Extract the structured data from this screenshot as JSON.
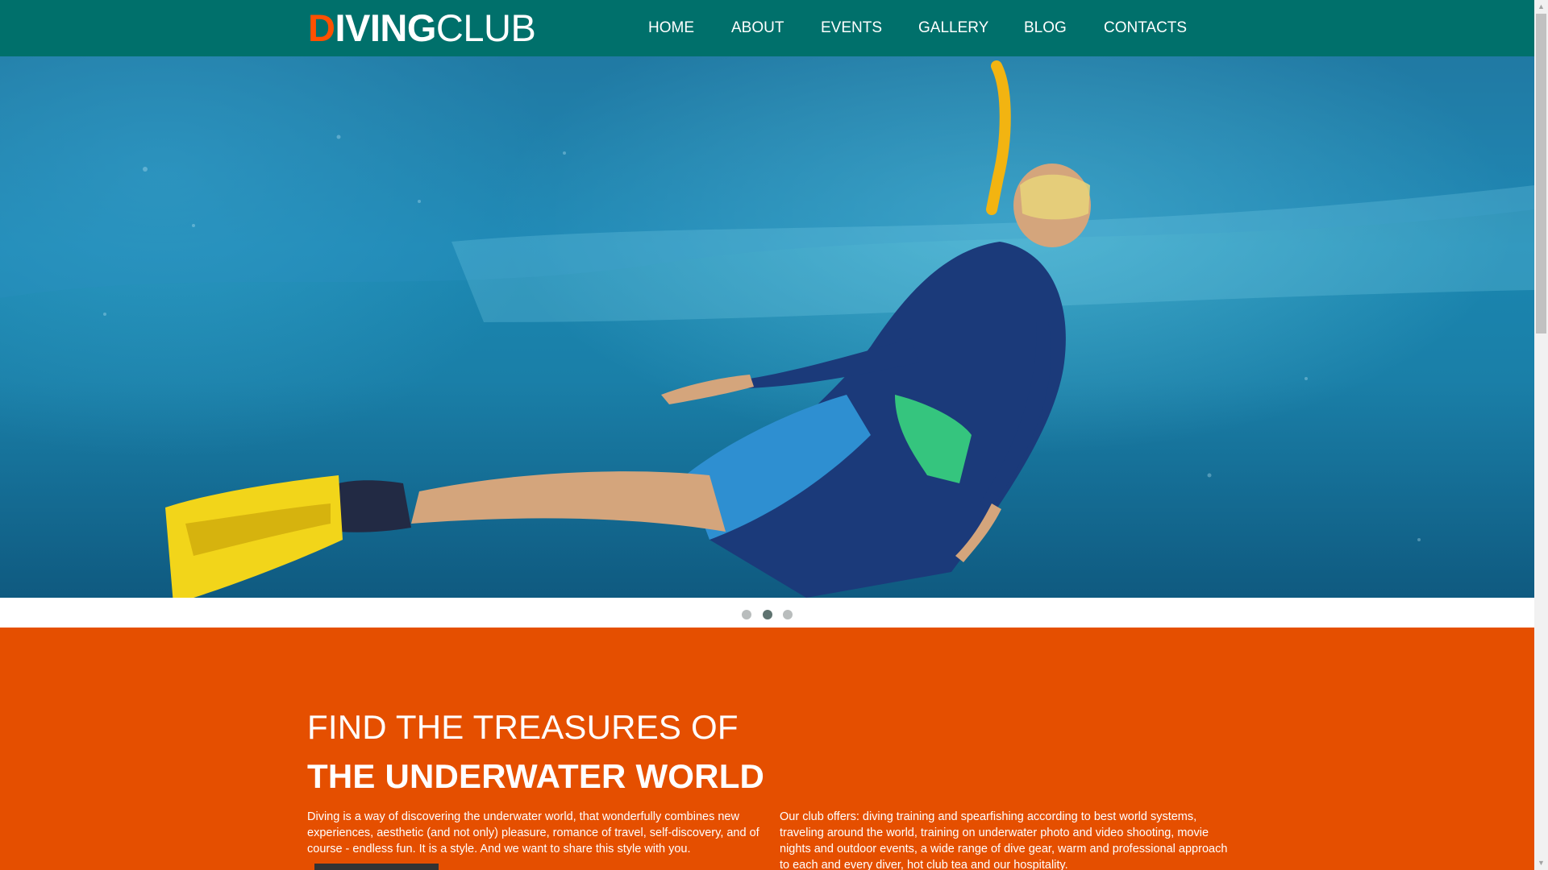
{
  "header": {
    "logo": {
      "first_letter": "D",
      "bold_part": "IVING",
      "light_part": "CLUB"
    },
    "nav": [
      {
        "label": "HOME"
      },
      {
        "label": "ABOUT"
      },
      {
        "label": "EVENTS"
      },
      {
        "label": "GALLERY"
      },
      {
        "label": "BLOG"
      },
      {
        "label": "CONTACTS"
      }
    ]
  },
  "slider": {
    "count": 3,
    "active_index": 1
  },
  "intro": {
    "heading_line1": "FIND THE TREASURES OF",
    "heading_line2": "THE UNDERWATER WORLD",
    "paragraph_left": "Diving is a way of discovering the underwater world, that wonderfully combines new experiences, aesthetic (and not only) pleasure, romance of travel, self-discovery, and of course - endless fun. It is a style. And we want to share this style with you.",
    "paragraph_right": "Our club offers: diving training and spearfishing according to best world systems, traveling around the world, training on underwater photo and video shooting, movie nights and outdoor events, a wide range of dive gear, warm and professional approach to each and every diver, hot club tea and our hospitality."
  },
  "colors": {
    "header_bg": "#00706b",
    "accent_orange": "#e54f00",
    "logo_accent": "#ff5000",
    "button_dark": "#333333"
  }
}
